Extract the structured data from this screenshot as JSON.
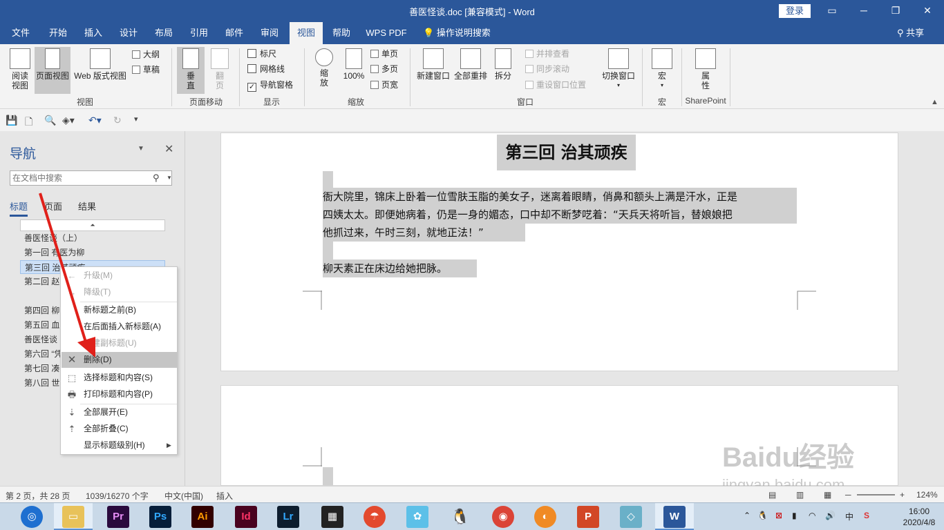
{
  "window": {
    "title": "善医怪谈.doc [兼容模式]  -  Word",
    "login": "登录",
    "minimize_icon": "minimize-icon",
    "restore_icon": "restore-icon",
    "close_icon": "close-icon"
  },
  "tabs": [
    "文件",
    "开始",
    "插入",
    "设计",
    "布局",
    "引用",
    "邮件",
    "审阅",
    "视图",
    "帮助",
    "WPS PDF"
  ],
  "active_tab": "视图",
  "tell_me": "操作说明搜索",
  "share": "共享",
  "ribbon": {
    "views": {
      "read_mode": "阅读\n视图",
      "print_layout": "页面视图",
      "web_layout": "Web 版式视图",
      "outline": "大纲",
      "draft": "草稿",
      "group_label": "视图"
    },
    "page_movement": {
      "vertical": "垂\n直",
      "side_to_side": "翻\n页",
      "group_label": "页面移动"
    },
    "show": {
      "ruler": "标尺",
      "ruler_checked": false,
      "gridlines": "网格线",
      "gridlines_checked": false,
      "nav_pane": "导航窗格",
      "nav_pane_checked": true,
      "group_label": "显示"
    },
    "zoom": {
      "zoom": "缩\n放",
      "hundred": "100%",
      "one_page": "单页",
      "multiple_pages": "多页",
      "page_width": "页宽",
      "group_label": "缩放"
    },
    "window": {
      "new_window": "新建窗口",
      "arrange_all": "全部重排",
      "split": "拆分",
      "side_by_side": "并排查看",
      "sync_scroll": "同步滚动",
      "reset_position": "重设窗口位置",
      "switch_windows": "切换窗口",
      "group_label": "窗口"
    },
    "macros": {
      "macros": "宏",
      "group_label": "宏"
    },
    "sharepoint": {
      "properties": "属\n性",
      "group_label": "SharePoint"
    }
  },
  "nav_pane": {
    "title": "导航",
    "search_placeholder": "在文档中搜索",
    "tabs": [
      "标题",
      "页面",
      "结果"
    ],
    "headings": [
      "善医怪谈（上）",
      "第一回  有医为柳",
      "第三回  治其顽疾",
      "第二回  赵",
      "第四回  柳",
      "第五回  血",
      "善医怪谈",
      "第六回 “凭",
      "第七回  凑",
      "第八回  世"
    ]
  },
  "context_menu": [
    {
      "label": "升级(M)",
      "disabled": true,
      "icon": "promote-icon"
    },
    {
      "label": "降级(T)",
      "disabled": true,
      "icon": "demote-icon"
    },
    {
      "label": "新标题之前(B)",
      "disabled": false,
      "icon": ""
    },
    {
      "label": "在后面插入新标题(A)",
      "disabled": false,
      "icon": ""
    },
    {
      "label": "新建副标题(U)",
      "disabled": true,
      "icon": ""
    },
    {
      "label": "删除(D)",
      "disabled": false,
      "icon": "delete-x-icon",
      "highlight": true
    },
    {
      "label": "选择标题和内容(S)",
      "disabled": false,
      "icon": "select-icon"
    },
    {
      "label": "打印标题和内容(P)",
      "disabled": false,
      "icon": "print-icon"
    },
    {
      "label": "全部展开(E)",
      "disabled": false,
      "icon": "expand-icon"
    },
    {
      "label": "全部折叠(C)",
      "disabled": false,
      "icon": "collapse-icon"
    },
    {
      "label": "显示标题级别(H)",
      "disabled": false,
      "icon": "",
      "submenu": true
    }
  ],
  "document": {
    "heading": "第三回  治其顽疾",
    "lines": [
      "衙大院里，锦床上卧着一位雪肤玉脂的美女子，迷离着眼睛，俏鼻和额头上满是汗水，正是",
      "四姨太太。即便她病着，仍是一身的媚态，口中却不断梦呓着：“天兵天将听旨，替娘娘把",
      "他抓过来，午时三刻，就地正法！”"
    ],
    "line2": "柳天素正在床边给她把脉。"
  },
  "status": {
    "page": "第 2 页，共 28 页",
    "words": "1039/16270 个字",
    "language": "中文(中国)",
    "mode": "插入",
    "zoom": "124%"
  },
  "taskbar": {
    "apps": [
      "Pr",
      "Ps",
      "Ai",
      "Id",
      "Lr"
    ],
    "time": "16:00",
    "date": "2020/4/8",
    "ime": "中"
  },
  "watermark": {
    "text": "Baidu经验",
    "url": "jingyan.baidu.com"
  }
}
